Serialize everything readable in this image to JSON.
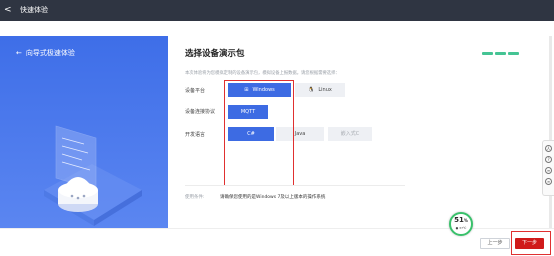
{
  "topbar": {
    "back_glyph": "<",
    "title": "快速体验"
  },
  "left_panel": {
    "wizard_label": "向导式极速体验",
    "arrow_glyph": "←"
  },
  "main": {
    "heading": "选择设备演示包",
    "description": "本次体验将为您模拟定制的设备演示包，模拟设备上报数据。请您根据需要选择：",
    "platform": {
      "label": "设备平台",
      "options": [
        {
          "label": "Windows",
          "icon": "windows-icon",
          "glyph": "⊞"
        },
        {
          "label": "Linux",
          "icon": "linux-penguin-icon",
          "glyph": "🐧"
        }
      ],
      "selected": "Windows"
    },
    "protocol": {
      "label": "设备连接协议",
      "options": [
        {
          "label": "MQTT"
        }
      ],
      "selected": "MQTT"
    },
    "language": {
      "label": "开发语言",
      "options": [
        {
          "label": "C#"
        },
        {
          "label": "Java"
        },
        {
          "label": "嵌入式C"
        }
      ],
      "selected": "C#"
    },
    "usage": {
      "label": "使用条件:",
      "text": "请确保您使用的是Windows 7及以上版本的操作系统"
    }
  },
  "footer": {
    "prev_label": "上一步",
    "next_label": "下一步"
  },
  "gauge": {
    "percent": "51",
    "percent_sign": "%",
    "temp": "● 37℃"
  },
  "sidedock": {
    "icons": [
      "user-icon",
      "help-icon",
      "document-icon",
      "chat-icon"
    ],
    "glyphs": [
      "人",
      "?",
      "≡",
      "∞"
    ]
  },
  "colors": {
    "primary": "#3d6be3",
    "accent_red": "#d01a1a",
    "highlight_border": "#e03030",
    "step_green": "#45c494",
    "topbar": "#2f3542"
  }
}
